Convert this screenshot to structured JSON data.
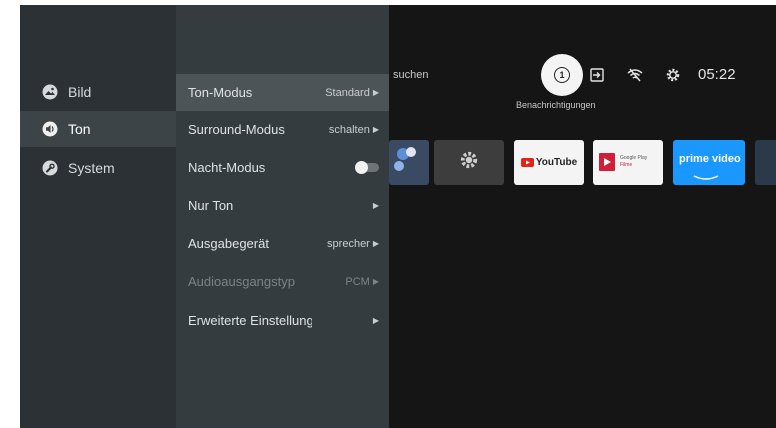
{
  "sidebar": {
    "items": [
      {
        "label": "Bild",
        "icon": "picture-icon"
      },
      {
        "label": "Ton",
        "icon": "sound-icon"
      },
      {
        "label": "System",
        "icon": "wrench-icon"
      }
    ]
  },
  "menu": {
    "items": [
      {
        "label": "Ton-Modus",
        "value": "Standard",
        "state": "active"
      },
      {
        "label": "Surround-Modus",
        "value": "schalten"
      },
      {
        "label": "Nacht-Modus",
        "toggle": "off"
      },
      {
        "label": "Nur Ton",
        "value": ""
      },
      {
        "label": "Ausgabegerät",
        "value": "sprecher"
      },
      {
        "label": "Audioausgangstyp",
        "value": "PCM",
        "state": "disabled"
      },
      {
        "label": "Erweiterte Einstellung",
        "value": ""
      }
    ]
  },
  "topbar": {
    "search_text": "suchen",
    "notifications_label": "Benachrichtigungen",
    "notification_count": "1",
    "clock": "05:22"
  },
  "apps": [
    {
      "name": "YouTube",
      "label": "YouTube",
      "color": "#ffffff"
    },
    {
      "name": "Google Play Filme",
      "label": "Google Play",
      "sub": "Filme",
      "color": "#ffffff"
    },
    {
      "name": "Prime Video",
      "label": "prime video",
      "color": "#1a98ff"
    }
  ],
  "colors": {
    "sidebar_bg": "#2b3135",
    "panel_bg": "#353c40",
    "active_item": "#4d5458",
    "screen_bg": "#151515"
  }
}
